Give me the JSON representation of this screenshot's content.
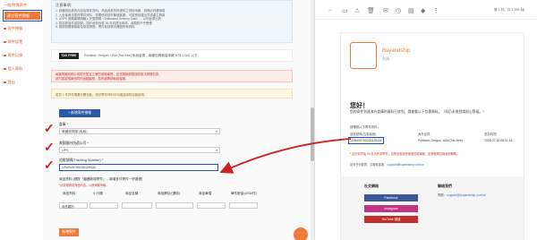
{
  "sidebar": {
    "header": "一般/特殊寄件",
    "active_item": "建立寄件預報",
    "items": [
      {
        "label": "寄件預報"
      },
      {
        "label": "寄件設置"
      },
      {
        "label": "寄件記錄"
      },
      {
        "label": "個人資料"
      },
      {
        "label": "登出"
      }
    ]
  },
  "notice": {
    "title": "注意事項：",
    "lines": [
      "1. 請確認包裹的內容及寄件資料，商品將依您所提供之資料申報，請務必詳實填寫",
      "2. 入倉後無法更改寄件資料，如需修改請先聯絡客服，可能會延遲出貨或產生費用",
      "3. USPS 追蹤編號請輸入完整號碼（Estimated Delivery Date），以利倉庫比對",
      "4. 若包裹遺失或損毀，請於收到包裹 30 天內提出申請，逾期將不予受理",
      "5. 請詳閱服務條款及常見問題，寄件前請再次確認所有資料"
    ]
  },
  "tax": {
    "badge": "TAX FREE",
    "text": "Portland, Oregon, USA (Tax-free) 免稅倉庫，每筆包裹最高申報 NT$ 2,000 以下"
  },
  "warnings": {
    "red_line1": "每筆預報請務必填寫完整且正確的追蹤編號，如追蹤編號錯誤將無法辨識包裹。",
    "red_line2": "請勿重複預報相同的追蹤編號，若有疑問請聯絡客服。",
    "info": "若您 1 件貨件需要分開包裝，請於寄件資料中勾選並填寫包裝說明。"
  },
  "add_button": "+ 新增寄件預報",
  "form": {
    "country_label": "倉庫 *",
    "country_value": "美國波特蘭 (免稅)",
    "carrier_label": "美國國內快遞公司 *",
    "carrier_value": "UPS",
    "tracking_label": "追蹤號碼(Tracking Number) *",
    "tracking_value": "1ZW4V0700230129432",
    "product_label": "商品資料 (請按「繼續新增寄件」…新增多件寄件一併處理)",
    "product_note": "*請詳細填寫商品內容，以便海關申報。",
    "columns": [
      "商品資料",
      "小分類",
      "商品名稱",
      "商品網址/(選填)",
      "商品單價",
      "單件數量(USD/件)"
    ],
    "category_value": "商品類別",
    "submit": "新增寄件"
  },
  "email": {
    "count": "第 1 封，共 1,799 封",
    "brand_name": "Buyandship",
    "brand_sub": "台灣",
    "hello": "您好！",
    "paragraph": "您的寄件到達海外倉庫的資料已收到，請查看以下包裹資料。（如仍未收到請耐心等候。）",
    "small": "請確認以下寄件資料：",
    "table_headers": [
      "追蹤號碼(包裹編號)",
      "海外倉庫",
      "更新時間"
    ],
    "tracking": "1ZW4V0700230129432",
    "warehouse": "Portland, Oregon, USA (Tax-free)",
    "updated": "2018-07-20 08:01:15",
    "warn": "* 請於到貨後 30 天內完成寄件，否則包裹將會被退回或棄置，如有疑問請與我們聯繫。",
    "link_text": "如有任何疑問，請聯繫客服：",
    "link_email": "support@buyandship.com.tw",
    "footer_social": "社交網絡",
    "footer_contact": "聯絡我們",
    "social_buttons": [
      "Facebook",
      "Instagram",
      "YouTube 頻道"
    ],
    "contact_label": "電郵：",
    "contact_email": "support@buyandship.com.tw"
  },
  "colors": {
    "brand": "#f07a3a",
    "highlight": "#1f4fd6",
    "alert": "#c22222"
  }
}
